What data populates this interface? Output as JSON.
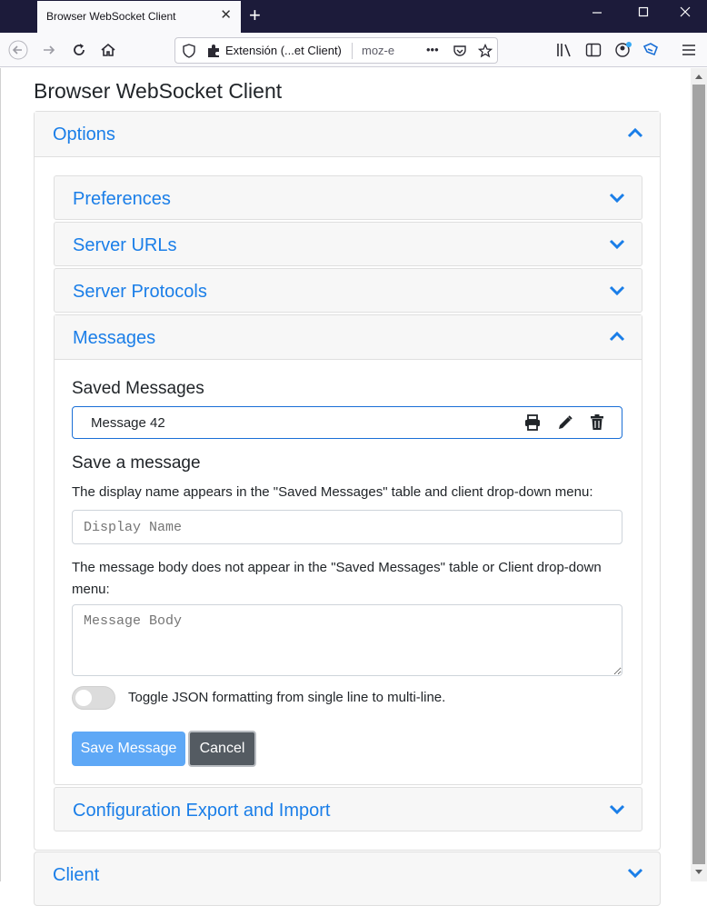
{
  "browser": {
    "tab_title": "Browser WebSocket Client",
    "tab_close": "✕",
    "new_tab": "+",
    "url_extension_label": "Extensión (...et Client)",
    "url_scheme_text": "moz-e",
    "url_more": "•••"
  },
  "page": {
    "title": "Browser WebSocket Client",
    "options": {
      "header": "Options",
      "sections": {
        "preferences": "Preferences",
        "server_urls": "Server URLs",
        "server_protocols": "Server Protocols",
        "messages": "Messages",
        "config_export": "Configuration Export and Import"
      },
      "messages": {
        "saved_heading": "Saved Messages",
        "saved_items": [
          {
            "name": "Message 42"
          }
        ],
        "save_heading": "Save a message",
        "display_name_help": "The display name appears in the \"Saved Messages\" table and client drop-down menu:",
        "display_name_placeholder": "Display Name",
        "body_help": "The message body does not appear in the \"Saved Messages\" table or Client drop-down menu:",
        "body_placeholder": "Message Body",
        "toggle_label": "Toggle JSON formatting from single line to multi-line.",
        "toggle_on": false,
        "save_button": "Save Message",
        "cancel_button": "Cancel"
      }
    },
    "client": {
      "header": "Client"
    }
  },
  "colors": {
    "link_blue": "#1a7ee8",
    "save_button_bg": "#5ea8f6",
    "cancel_button_bg": "#545b62",
    "titlebar": "#1c1b3a"
  }
}
